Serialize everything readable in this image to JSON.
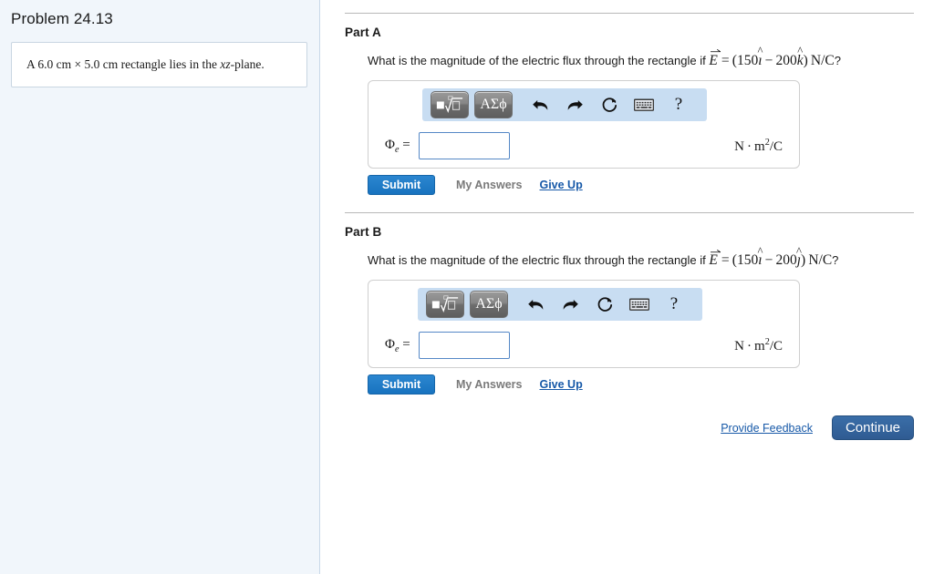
{
  "sidebar": {
    "problem_title": "Problem 24.13",
    "problem_statement_prefix": "A ",
    "problem_dim1": "6.0 cm",
    "problem_times": "×",
    "problem_dim2": "5.0 cm",
    "problem_mid": " rectangle lies in the ",
    "problem_plane": "xz",
    "problem_suffix": "-plane."
  },
  "parts": [
    {
      "label": "Part A",
      "question_prefix": "What is the magnitude of the electric flux through the rectangle if ",
      "math": {
        "E": "E",
        "equals": "=",
        "open_paren": "(",
        "coef1": "150",
        "unit1": "ı",
        "hat1": "^",
        "minus": "−",
        "coef2": "200",
        "unit2": "k",
        "hat2": "^",
        "close_paren": ")",
        "units_inline": "N/C"
      },
      "question_suffix": "?",
      "toolbar": {
        "sqrt_button_label": "sqrt-template",
        "greek_button_label": "ΑΣϕ",
        "undo_label": "undo",
        "redo_label": "redo",
        "reset_label": "reset",
        "keyboard_label": "keyboard",
        "help_label": "?"
      },
      "answer": {
        "symbol": "Φ",
        "subscript": "e",
        "eq": "=",
        "value": "",
        "placeholder": "",
        "units": "N · m²/C",
        "units_N": "N",
        "units_dot": "·",
        "units_m": "m",
        "units_exp": "2",
        "units_div": "/C"
      },
      "actions": {
        "submit": "Submit",
        "my_answers": "My Answers",
        "give_up": "Give Up"
      }
    },
    {
      "label": "Part B",
      "question_prefix": "What is the magnitude of the electric flux through the rectangle if ",
      "math": {
        "E": "E",
        "equals": "=",
        "open_paren": "(",
        "coef1": "150",
        "unit1": "ı",
        "hat1": "^",
        "minus": "−",
        "coef2": "200",
        "unit2": "ȷ",
        "hat2": "^",
        "close_paren": ")",
        "units_inline": "N/C"
      },
      "question_suffix": "?",
      "toolbar": {
        "sqrt_button_label": "sqrt-template",
        "greek_button_label": "ΑΣϕ",
        "undo_label": "undo",
        "redo_label": "redo",
        "reset_label": "reset",
        "keyboard_label": "keyboard",
        "help_label": "?"
      },
      "answer": {
        "symbol": "Φ",
        "subscript": "e",
        "eq": "=",
        "value": "",
        "placeholder": "",
        "units": "N · m²/C",
        "units_N": "N",
        "units_dot": "·",
        "units_m": "m",
        "units_exp": "2",
        "units_div": "/C"
      },
      "actions": {
        "submit": "Submit",
        "my_answers": "My Answers",
        "give_up": "Give Up"
      }
    }
  ],
  "footer": {
    "provide_feedback": "Provide Feedback",
    "continue": "Continue"
  },
  "colors": {
    "sidebar_bg": "#f1f6fb",
    "toolbar_bg": "#c8ddf2",
    "submit_blue": "#1c7ac9",
    "continue_blue": "#2f5b92",
    "link_blue": "#1759a8",
    "input_border": "#5588c6"
  }
}
